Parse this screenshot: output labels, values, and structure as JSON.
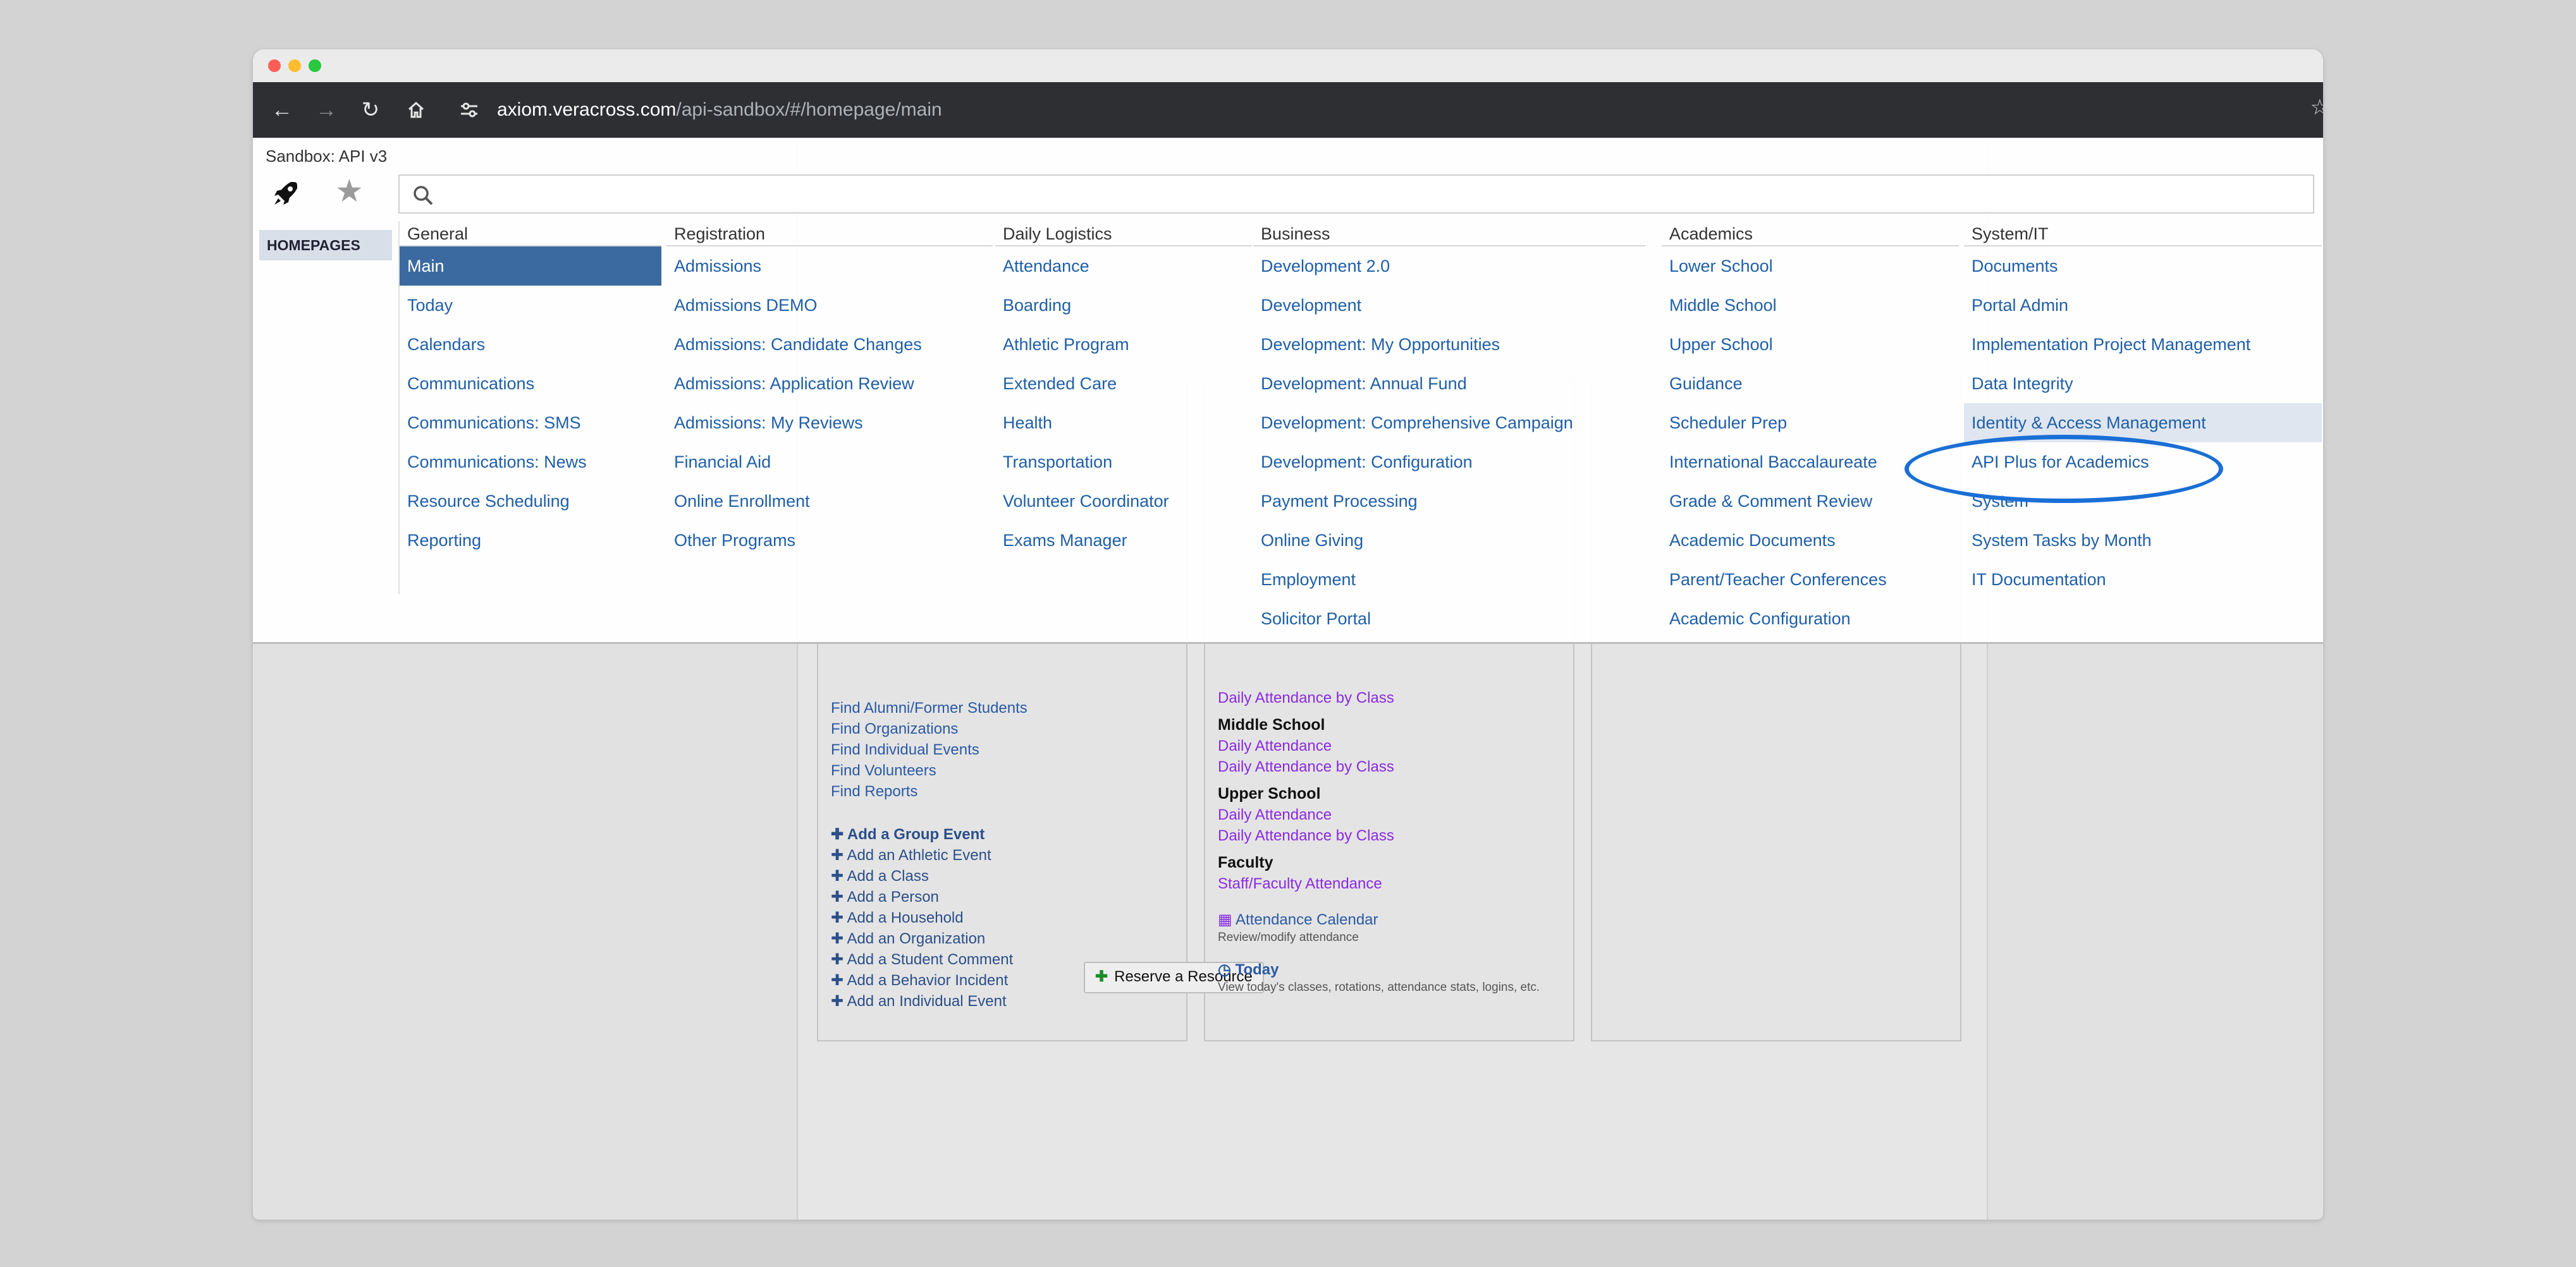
{
  "browser": {
    "url_host": "axiom.veracross.com",
    "url_path": "/api-sandbox/#/homepage/main"
  },
  "app": {
    "sandbox_label": "Sandbox: API v3",
    "homepages_tab": "HOMEPAGES"
  },
  "menu": {
    "columns": [
      {
        "header": "General",
        "items": [
          "Main",
          "Today",
          "Calendars",
          "Communications",
          "Communications: SMS",
          "Communications: News",
          "Resource Scheduling",
          "Reporting"
        ]
      },
      {
        "header": "Registration",
        "items": [
          "Admissions",
          "Admissions DEMO",
          "Admissions: Candidate Changes",
          "Admissions: Application Review",
          "Admissions: My Reviews",
          "Financial Aid",
          "Online Enrollment",
          "Other Programs"
        ]
      },
      {
        "header": "Daily Logistics",
        "items": [
          "Attendance",
          "Boarding",
          "Athletic Program",
          "Extended Care",
          "Health",
          "Transportation",
          "Volunteer Coordinator",
          "Exams Manager"
        ]
      },
      {
        "header": "Business",
        "items": [
          "Development 2.0",
          "Development",
          "Development: My Opportunities",
          "Development: Annual Fund",
          "Development: Comprehensive Campaign",
          "Development: Configuration",
          "Payment Processing",
          "Online Giving",
          "Employment",
          "Solicitor Portal"
        ]
      },
      {
        "header": "Academics",
        "items": [
          "Lower School",
          "Middle School",
          "Upper School",
          "Guidance",
          "Scheduler Prep",
          "International Baccalaureate",
          "Grade & Comment Review",
          "Academic Documents",
          "Parent/Teacher Conferences",
          "Academic Configuration"
        ]
      },
      {
        "header": "System/IT",
        "items": [
          "Documents",
          "Portal Admin",
          "Implementation Project Management",
          "Data Integrity",
          "Identity & Access Management",
          "API Plus for Academics",
          "System",
          "System Tasks by Month",
          "IT Documentation"
        ]
      }
    ]
  },
  "underlying": {
    "find_links": [
      "Find Alumni/Former Students",
      "Find Organizations",
      "Find Individual Events",
      "Find Volunteers",
      "Find Reports"
    ],
    "add_links": [
      "Add a Group Event",
      "Add an Athletic Event",
      "Add a Class",
      "Add a Person",
      "Add a Household",
      "Add an Organization",
      "Add a Student Comment",
      "Add a Behavior Incident",
      "Add an Individual Event"
    ],
    "reserve_label": "Reserve a Resource",
    "attendance": {
      "lower_link": "Daily Attendance by Class",
      "middle_title": "Middle School",
      "middle_links": [
        "Daily Attendance",
        "Daily Attendance by Class"
      ],
      "upper_title": "Upper School",
      "upper_links": [
        "Daily Attendance",
        "Daily Attendance by Class"
      ],
      "faculty_title": "Faculty",
      "faculty_link": "Staff/Faculty Attendance",
      "calendar_link": "Attendance Calendar",
      "calendar_desc": "Review/modify attendance",
      "today_link": "Today",
      "today_desc": "View today's classes, rotations, attendance stats, logins, etc."
    }
  }
}
